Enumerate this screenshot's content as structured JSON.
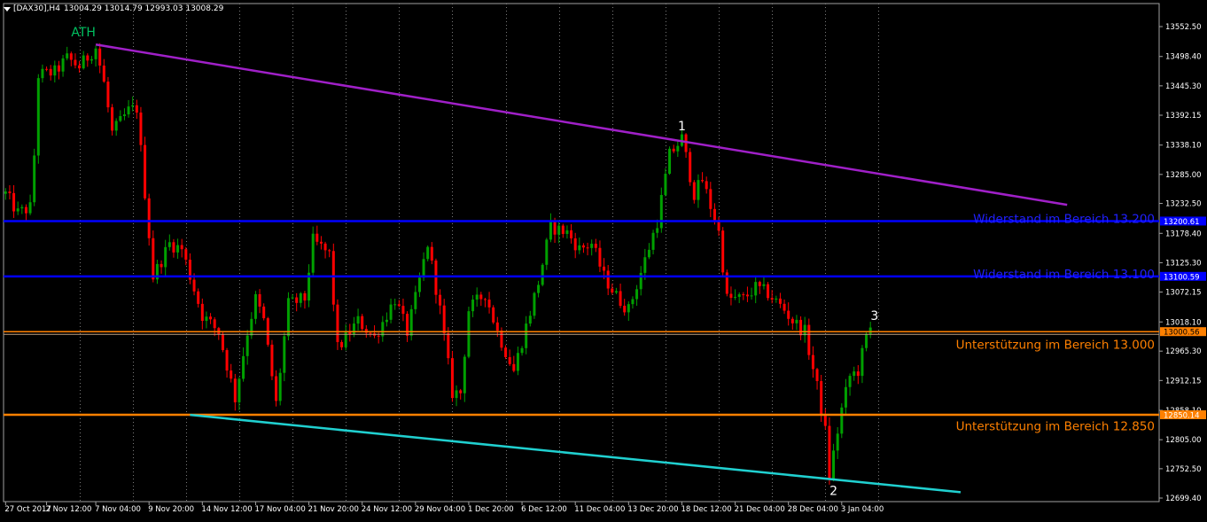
{
  "header": {
    "menu_icon": "triangle-down-icon",
    "symbol": "[DAX30],H4",
    "quote": "13004.29 13014.79 12993.03 13008.29"
  },
  "colors": {
    "background": "#000000",
    "grid": "#7a7a7a",
    "bull": "#00a000",
    "bear": "#ff0000",
    "ath_line": "#a020c8",
    "support_trend": "#20d0d0",
    "resistance": "#0000ff",
    "support": "#ff8000",
    "price_line": "#c0a080"
  },
  "chart_data": {
    "type": "candlestick",
    "timeframe": "H4",
    "y_range": [
      12672,
      13580
    ],
    "price_ticks": [
      "13552.50",
      "13498.40",
      "13445.30",
      "13392.15",
      "13338.10",
      "13285.00",
      "13232.50",
      "13178.40",
      "13125.30",
      "13072.15",
      "13018.10",
      "12965.30",
      "12912.15",
      "12858.10",
      "12805.00",
      "12752.50",
      "12699.40"
    ],
    "time_labels": [
      "27 Oct 2017",
      "2 Nov 12:00",
      "7 Nov 04:00",
      "9 Nov 20:00",
      "14 Nov 12:00",
      "17 Nov 04:00",
      "21 Nov 20:00",
      "24 Nov 12:00",
      "29 Nov 04:00",
      "1 Dec 20:00",
      "6 Dec 12:00",
      "11 Dec 04:00",
      "13 Dec 20:00",
      "18 Dec 12:00",
      "21 Dec 04:00",
      "28 Dec 04:00",
      "3 Jan 04:00"
    ],
    "time_label_bars": [
      0,
      10,
      22,
      35,
      48,
      61,
      74,
      87,
      100,
      113,
      126,
      139,
      152,
      165,
      178,
      191,
      204
    ],
    "grid_bars": [
      18,
      31,
      44,
      57,
      70,
      83,
      96,
      109,
      122,
      135,
      148,
      161,
      174,
      187,
      200,
      213
    ],
    "bar_count": 260,
    "current_price": "13000.56",
    "anchors": [
      [
        0,
        13250
      ],
      [
        3,
        13215
      ],
      [
        6,
        13225
      ],
      [
        7,
        13320
      ],
      [
        8,
        13465
      ],
      [
        12,
        13470
      ],
      [
        15,
        13495
      ],
      [
        18,
        13480
      ],
      [
        22,
        13515
      ],
      [
        24,
        13450
      ],
      [
        26,
        13360
      ],
      [
        30,
        13400
      ],
      [
        32,
        13405
      ],
      [
        36,
        13100
      ],
      [
        40,
        13160
      ],
      [
        43,
        13150
      ],
      [
        48,
        13030
      ],
      [
        52,
        13000
      ],
      [
        56,
        12880
      ],
      [
        59,
        13000
      ],
      [
        61,
        13060
      ],
      [
        63,
        13020
      ],
      [
        66,
        12870
      ],
      [
        69,
        13050
      ],
      [
        73,
        13060
      ],
      [
        75,
        13165
      ],
      [
        79,
        13140
      ],
      [
        81,
        12970
      ],
      [
        86,
        13020
      ],
      [
        90,
        12990
      ],
      [
        95,
        13060
      ],
      [
        98,
        13000
      ],
      [
        100,
        13060
      ],
      [
        103,
        13160
      ],
      [
        106,
        13040
      ],
      [
        109,
        12890
      ],
      [
        111,
        12890
      ],
      [
        113,
        13040
      ],
      [
        117,
        13070
      ],
      [
        120,
        13000
      ],
      [
        124,
        12930
      ],
      [
        127,
        13010
      ],
      [
        130,
        13090
      ],
      [
        133,
        13190
      ],
      [
        137,
        13180
      ],
      [
        140,
        13150
      ],
      [
        143,
        13160
      ],
      [
        146,
        13100
      ],
      [
        149,
        13065
      ],
      [
        152,
        13040
      ],
      [
        156,
        13130
      ],
      [
        159,
        13200
      ],
      [
        162,
        13320
      ],
      [
        165,
        13350
      ],
      [
        168,
        13250
      ],
      [
        170,
        13275
      ],
      [
        174,
        13180
      ],
      [
        176,
        13060
      ],
      [
        180,
        13060
      ],
      [
        183,
        13080
      ],
      [
        186,
        13070
      ],
      [
        190,
        13040
      ],
      [
        192,
        13020
      ],
      [
        195,
        13000
      ],
      [
        198,
        12900
      ],
      [
        200,
        12820
      ],
      [
        201,
        12740
      ],
      [
        202,
        12780
      ],
      [
        204,
        12860
      ],
      [
        206,
        12920
      ],
      [
        208,
        12930
      ],
      [
        210,
        12990
      ],
      [
        211,
        13008
      ]
    ],
    "lines": {
      "ath_trend": {
        "from": [
          22,
          13520
        ],
        "to": [
          259,
          13230
        ]
      },
      "support_trend": {
        "from": [
          45,
          12850
        ],
        "to": [
          233,
          12710
        ]
      }
    },
    "levels": [
      {
        "price": 13200.61,
        "tag": "13200.61",
        "color": "#0000ff"
      },
      {
        "price": 13100.59,
        "tag": "13100.59",
        "color": "#0000ff"
      },
      {
        "price": 13000.56,
        "tag": "13000.56",
        "color": "#ff8000"
      },
      {
        "price": 12850.14,
        "tag": "12850.14",
        "color": "#ff8000"
      }
    ],
    "annotations": [
      {
        "text": "ATH",
        "bar": 19,
        "price": 13535,
        "color": "#00c060",
        "size": 14
      },
      {
        "text": "1",
        "bar": 165,
        "price": 13365,
        "color": "#ffffff",
        "size": 14
      },
      {
        "text": "2",
        "bar": 202,
        "price": 12705,
        "color": "#ffffff",
        "size": 14
      },
      {
        "text": "3",
        "bar": 212,
        "price": 13022,
        "color": "#ffffff",
        "size": 14
      }
    ],
    "level_labels": [
      {
        "text": "Widerstand im Bereich 13.200",
        "price": 13205,
        "color": "#2020ff"
      },
      {
        "text": "Widerstand im Bereich 13.100",
        "price": 13105,
        "color": "#2020ff"
      },
      {
        "text": "Unterstützung im Bereich 13.000",
        "price": 12978,
        "color": "#ff8000"
      },
      {
        "text": "Unterstützung im Bereich 12.850",
        "price": 12830,
        "color": "#ff8000"
      }
    ]
  }
}
